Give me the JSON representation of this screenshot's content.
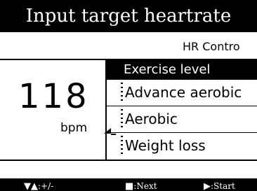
{
  "header": {
    "title": "Input target heartrate"
  },
  "subheader": {
    "text": "HR Contro"
  },
  "heartrate": {
    "value": "118",
    "unit": "bpm"
  },
  "exercise_list": {
    "header": "Exercise level",
    "items": [
      {
        "label": "Advance aerobic"
      },
      {
        "label": "Aerobic"
      },
      {
        "label": "Weight loss"
      }
    ]
  },
  "footer": {
    "hints": [
      {
        "icon": "up-down-triangle-icon",
        "glyph": "▼▲",
        "text": ":+/-"
      },
      {
        "icon": "square-icon",
        "glyph": "■",
        "text": ":Next"
      },
      {
        "icon": "play-icon",
        "glyph": "▶",
        "text": ":Start"
      }
    ]
  }
}
